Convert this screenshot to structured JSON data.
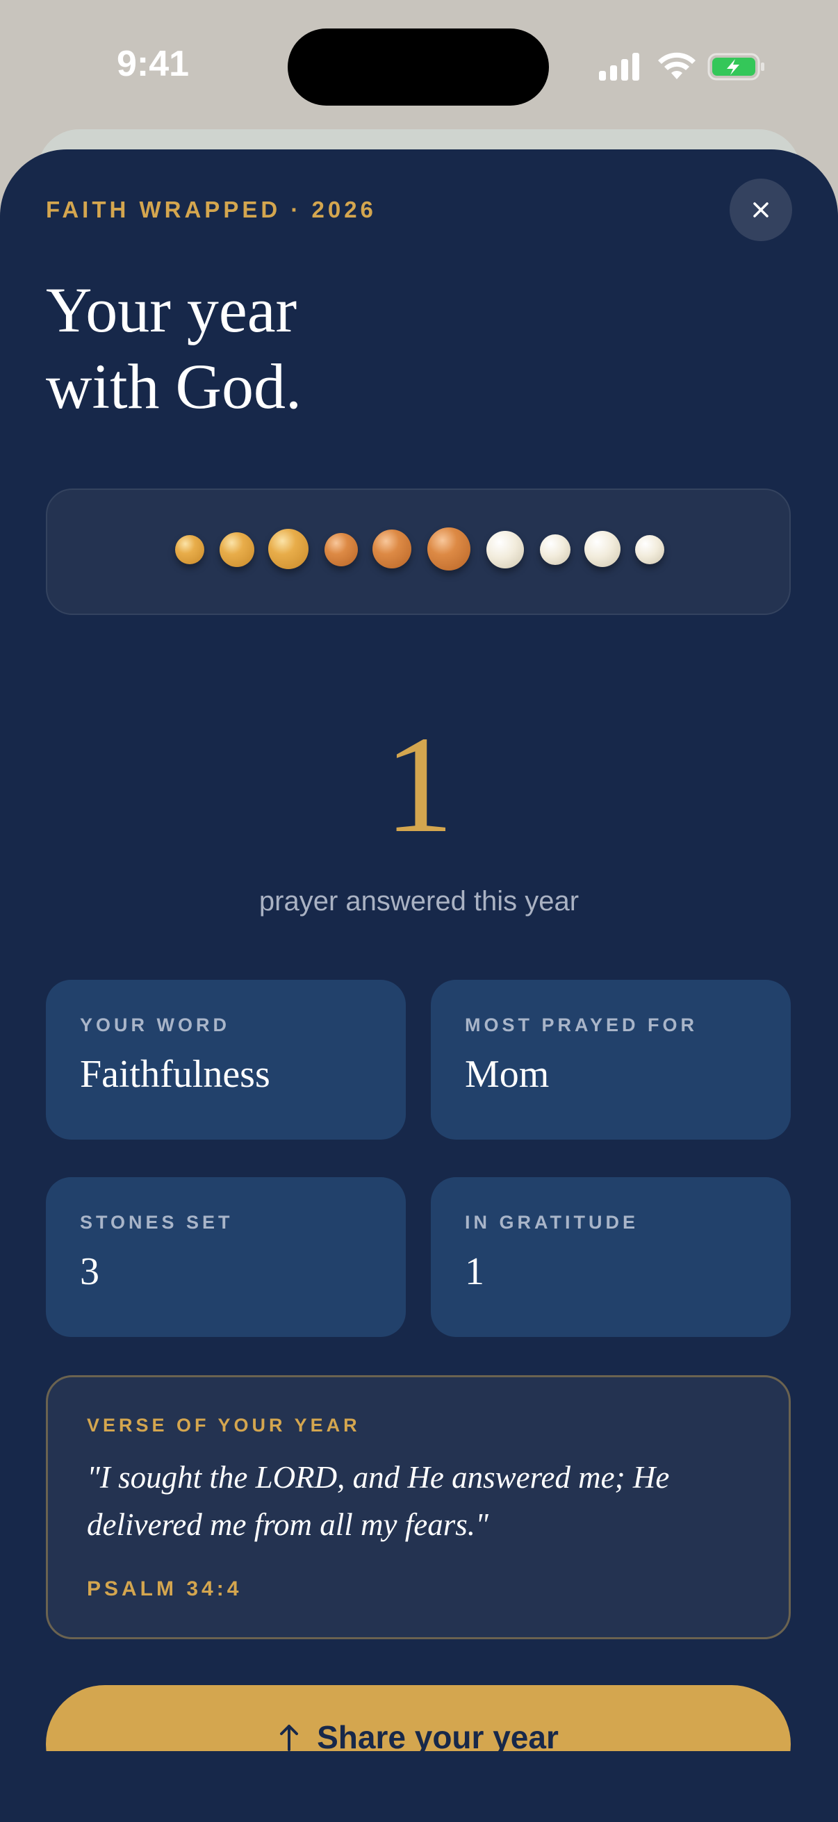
{
  "status_bar": {
    "time": "9:41"
  },
  "eyebrow": "FAITH WRAPPED · 2026",
  "headline": {
    "line1": "Your year",
    "line2": "with God."
  },
  "highlight": {
    "number": "1",
    "caption": "prayer answered this year"
  },
  "stats": [
    {
      "label": "YOUR WORD",
      "value": "Faithfulness"
    },
    {
      "label": "MOST PRAYED FOR",
      "value": "Mom"
    },
    {
      "label": "STONES SET",
      "value": "3"
    },
    {
      "label": "IN GRATITUDE",
      "value": "1"
    }
  ],
  "verse": {
    "label": "VERSE OF YOUR YEAR",
    "text": "\"I sought the LORD, and He answered me; He delivered me from all my fears.\"",
    "reference": "PSALM 34:4"
  },
  "share_button": {
    "label": "Share your year"
  },
  "colors": {
    "background": "#17284a",
    "accent_gold": "#d4a64f",
    "card": "#22416b"
  },
  "icons": [
    "signal-icon",
    "wifi-icon",
    "battery-charging-icon",
    "close-icon",
    "share-arrow-icon"
  ],
  "beads": [
    "gold",
    "gold",
    "gold",
    "copper",
    "copper",
    "copper",
    "pearl",
    "pearl",
    "pearl",
    "pearl"
  ]
}
